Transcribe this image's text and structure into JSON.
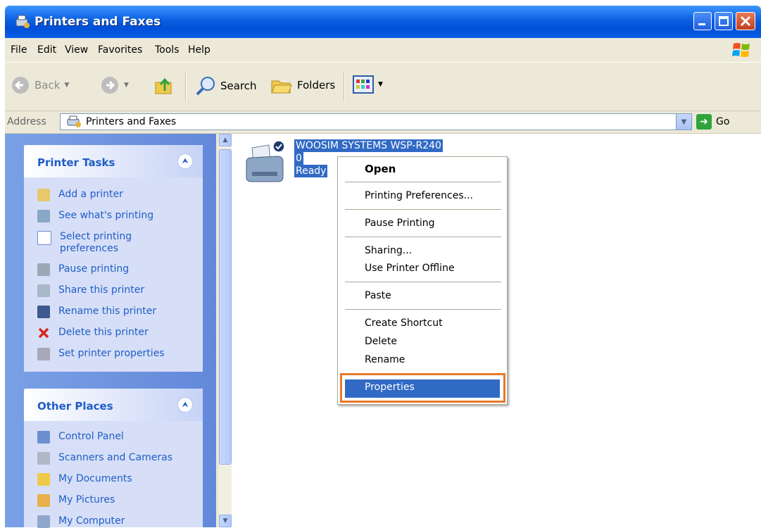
{
  "window": {
    "title": "Printers and Faxes"
  },
  "menu": [
    "File",
    "Edit",
    "View",
    "Favorites",
    "Tools",
    "Help"
  ],
  "toolbar": {
    "back": "Back",
    "search": "Search",
    "folders": "Folders"
  },
  "address": {
    "label": "Address",
    "value": "Printers and Faxes",
    "go": "Go"
  },
  "printer_tasks": {
    "title": "Printer Tasks",
    "items": [
      "Add a printer",
      "See what's printing",
      "Select printing preferences",
      "Pause printing",
      "Share this printer",
      "Rename this printer",
      "Delete this printer",
      "Set printer properties"
    ]
  },
  "other_places": {
    "title": "Other Places",
    "items": [
      "Control Panel",
      "Scanners and Cameras",
      "My Documents",
      "My Pictures",
      "My Computer"
    ]
  },
  "printer": {
    "name": "WOOSIM SYSTEMS WSP-R240",
    "jobs": "0",
    "status": "Ready"
  },
  "context_menu": [
    "Open",
    "Printing Preferences...",
    "Pause Printing",
    "Sharing...",
    "Use Printer Offline",
    "Paste",
    "Create Shortcut",
    "Delete",
    "Rename",
    "Properties"
  ],
  "colors": {
    "title_blue": "#0a5fe0",
    "selection": "#316ac5",
    "highlight_box": "#e57a2a",
    "link": "#215dc6"
  }
}
